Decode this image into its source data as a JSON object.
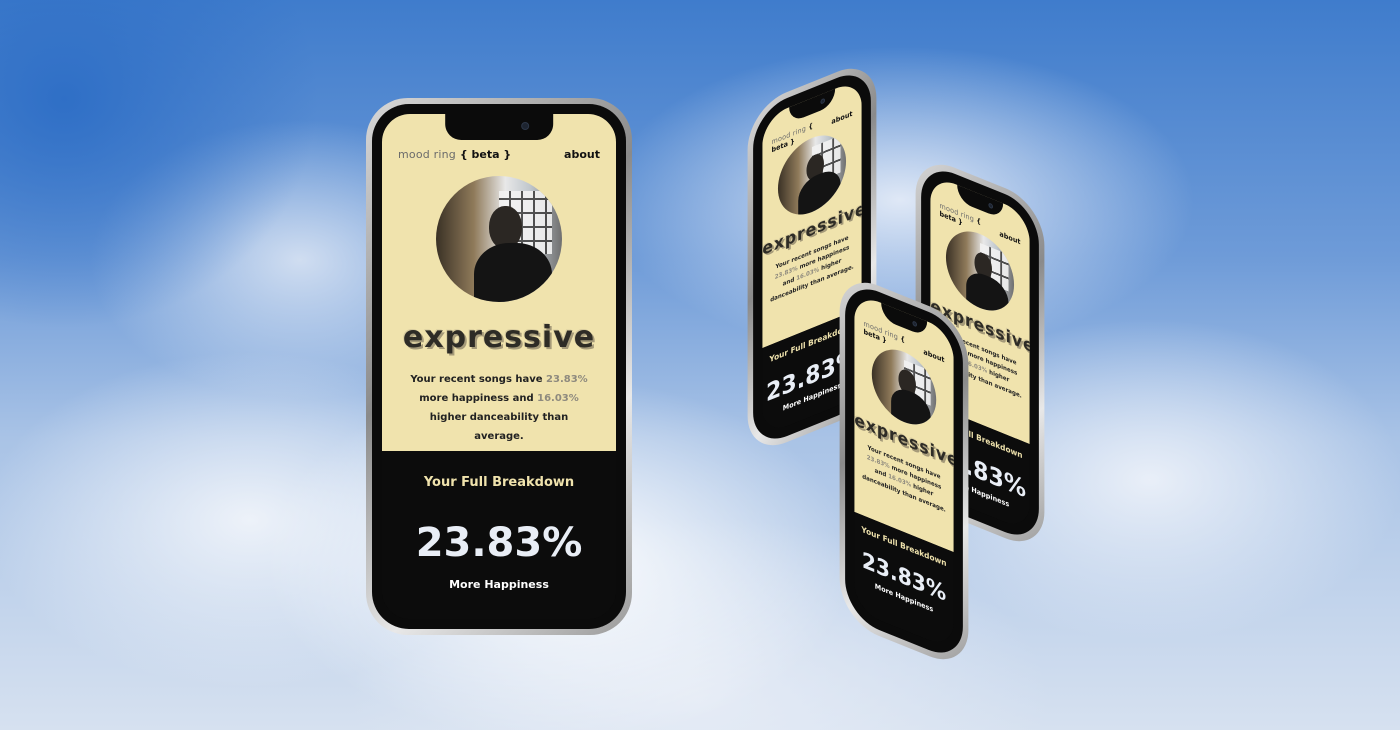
{
  "app": {
    "brand_name": "mood ring",
    "brand_tag": "{ beta }",
    "about_link": "about"
  },
  "profile": {
    "avatar_alt": "profile photo",
    "mood_word": "expressive",
    "summary_prefix": "Your recent songs have",
    "happiness_pct": "23.83%",
    "summary_mid": "more happiness and",
    "danceability_pct": "16.03%",
    "summary_suffix": "higher danceability than average."
  },
  "breakdown": {
    "title": "Your Full Breakdown",
    "big_value": "23.83%",
    "big_label": "More Happiness"
  },
  "colors": {
    "accent_yellow": "#f0e3ad",
    "dark_bg": "#0c0c0c",
    "muted_number": "#8e8a7e"
  }
}
